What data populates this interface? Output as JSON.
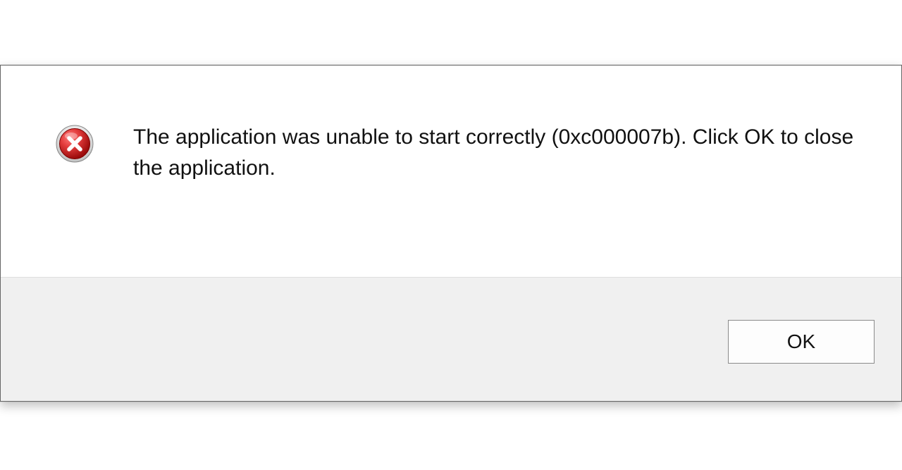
{
  "dialog": {
    "icon": "error-icon",
    "message": "The application was unable to start correctly (0xc000007b). Click OK to close the application.",
    "ok_label": "OK"
  }
}
